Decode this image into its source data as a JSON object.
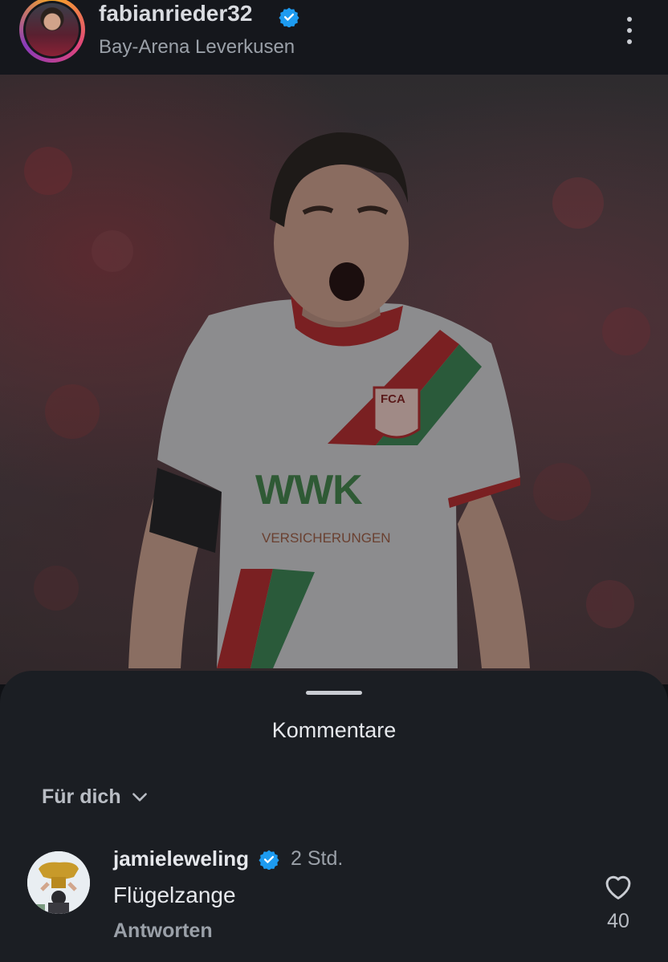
{
  "header": {
    "username": "fabianrieder32",
    "location": "Bay-Arena Leverkusen",
    "more_icon": "more-vertical-icon"
  },
  "post": {
    "image_description_icon": "post-photo",
    "jersey_sponsor": "WWK",
    "jersey_sponsor_sub": "VERSICHERUNGEN",
    "jersey_crest": "FCA"
  },
  "comments_sheet": {
    "title": "Kommentare",
    "sort_label": "Für dich",
    "comments": [
      {
        "username": "jamieleweling",
        "time": "2 Std.",
        "text": "Flügelzange",
        "reply_label": "Antworten",
        "likes": "40"
      }
    ]
  },
  "colors": {
    "verified": "#1d9bf0",
    "sheet_bg": "#1b1e23",
    "header_bg": "#15171c"
  }
}
